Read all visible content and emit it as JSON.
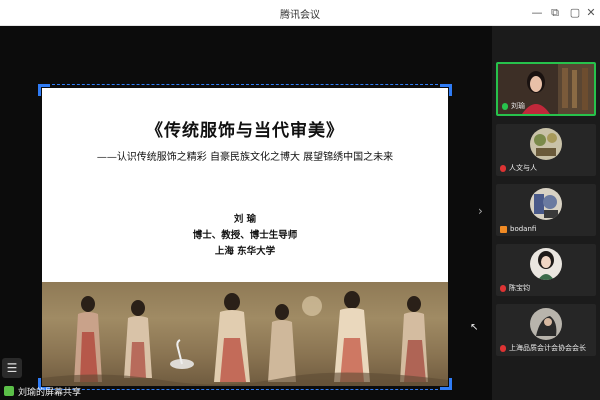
{
  "window": {
    "title": "腾讯会议"
  },
  "slide": {
    "title": "《传统服饰与当代审美》",
    "subtitle": "——认识传统服饰之精彩  自豪民族文化之博大  展望锦绣中国之未来",
    "author_name": "刘  瑜",
    "author_titles": "博士、教授、博士生导师",
    "author_affiliation": "上海  东华大学"
  },
  "share_status": {
    "label": "刘瑜的屏幕共享"
  },
  "participants": [
    {
      "name": "刘瑜",
      "mic": "on",
      "active": true
    },
    {
      "name": "人文与人",
      "mic": "muted",
      "active": false
    },
    {
      "name": "bodanfi",
      "mic": "orange",
      "active": false
    },
    {
      "name": "陈宝钧",
      "mic": "muted",
      "active": false
    },
    {
      "name": "上海品质会计会协会会长",
      "mic": "muted",
      "active": false
    }
  ],
  "icons": {
    "restore": "restore-icon",
    "minimize": "minimize-icon",
    "maximize": "maximize-icon",
    "close": "close-icon",
    "panel_toggle": "chevron-right-icon",
    "menu": "list-menu-icon"
  },
  "colors": {
    "accent": "#2f7cf6",
    "active_speaker": "#27c24c"
  }
}
